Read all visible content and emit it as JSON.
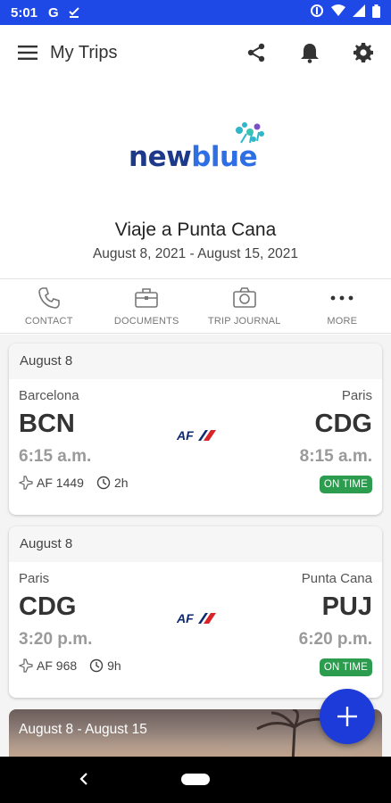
{
  "status_bar": {
    "time": "5:01"
  },
  "app_bar": {
    "title": "My Trips"
  },
  "brand": {
    "logo_part1": "new",
    "logo_part2": "blue"
  },
  "trip": {
    "title": "Viaje a Punta Cana",
    "dates": "August 8, 2021 - August 15, 2021"
  },
  "quick_actions": [
    {
      "label": "CONTACT",
      "icon": "phone-icon"
    },
    {
      "label": "DOCUMENTS",
      "icon": "briefcase-icon"
    },
    {
      "label": "TRIP JOURNAL",
      "icon": "camera-icon"
    },
    {
      "label": "MORE",
      "icon": "more-dots-icon"
    }
  ],
  "flights": [
    {
      "date": "August 8",
      "origin_city": "Barcelona",
      "origin_code": "BCN",
      "depart_time": "6:15 a.m.",
      "dest_city": "Paris",
      "dest_code": "CDG",
      "arrive_time": "8:15 a.m.",
      "airline_logo": "AF",
      "flight_number": "AF 1449",
      "duration": "2h",
      "status": "ON TIME"
    },
    {
      "date": "August 8",
      "origin_city": "Paris",
      "origin_code": "CDG",
      "depart_time": "3:20 p.m.",
      "dest_city": "Punta Cana",
      "dest_code": "PUJ",
      "arrive_time": "6:20 p.m.",
      "airline_logo": "AF",
      "flight_number": "AF 968",
      "duration": "9h",
      "status": "ON TIME"
    }
  ],
  "hotel": {
    "dates": "August 8 - August 15"
  },
  "colors": {
    "status_bar": "#1f49e6",
    "fab": "#1c3bd9",
    "badge": "#2c9c4f",
    "airline_red": "#d8232a",
    "airline_navy": "#0b2a6f"
  }
}
